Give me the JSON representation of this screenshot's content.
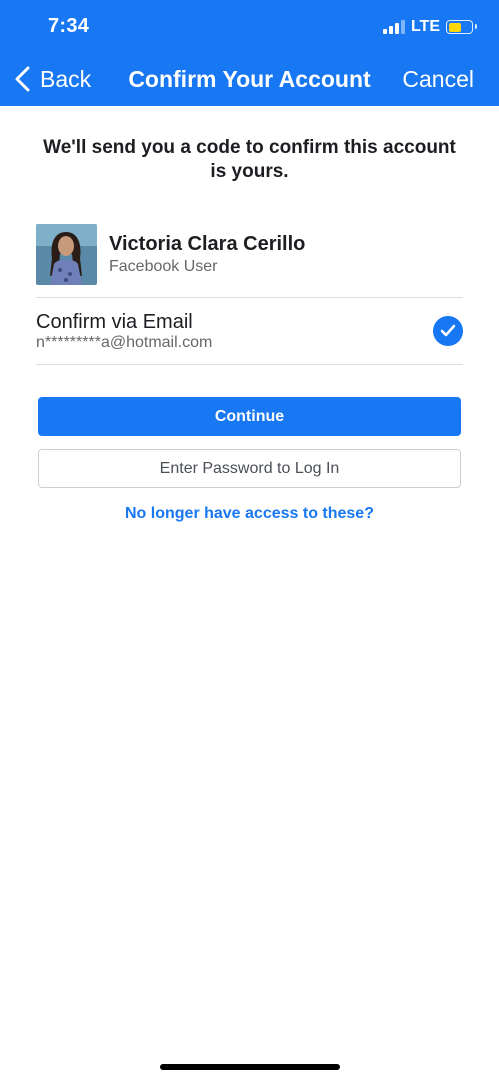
{
  "status_bar": {
    "time": "7:34",
    "network": "LTE",
    "signal_icon": "signal-bars-icon",
    "battery_icon": "battery-icon",
    "battery_color": "#ffd60a"
  },
  "nav": {
    "back_label": "Back",
    "back_icon": "chevron-left-icon",
    "title": "Confirm Your Account",
    "cancel_label": "Cancel",
    "bar_color": "#1877f2"
  },
  "intro_text": "We'll send you a code to confirm this account is yours.",
  "profile": {
    "name": "Victoria Clara Cerillo",
    "subtitle": "Facebook User"
  },
  "confirm_option": {
    "title": "Confirm via Email",
    "email": "n*********a@hotmail.com",
    "selected": true,
    "check_icon": "checkmark-circle-icon"
  },
  "actions": {
    "continue_label": "Continue",
    "password_label": "Enter Password to Log In",
    "no_access_link": "No longer have access to these?"
  },
  "colors": {
    "primary": "#1877f2",
    "secondary_text": "#65676b"
  }
}
